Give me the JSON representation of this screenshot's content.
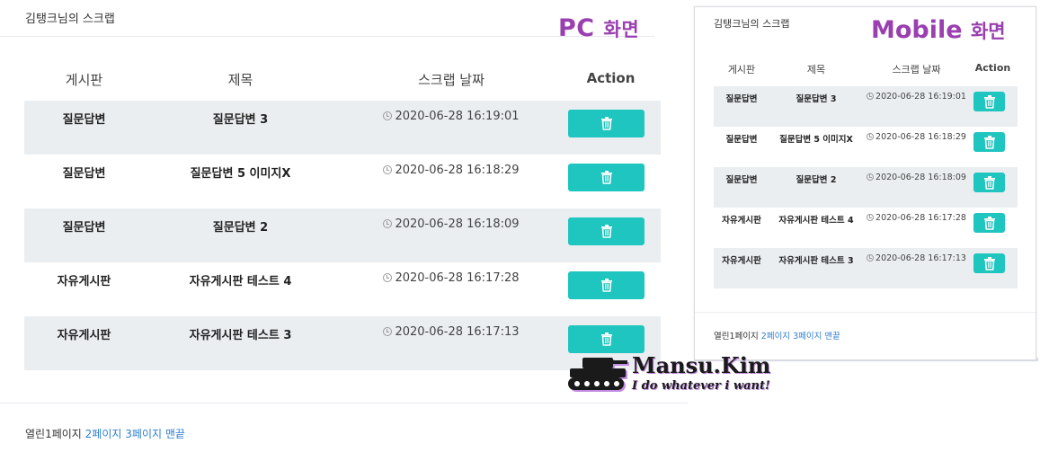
{
  "pc": {
    "title": "김탱크님의 스크랩",
    "badge_en": "PC",
    "badge_ko": "화면",
    "columns": [
      "게시판",
      "제목",
      "스크랩 날짜",
      "Action"
    ],
    "rows": [
      {
        "board": "질문답변",
        "title": "질문답변 3",
        "date": "2020-06-28 16:19:01"
      },
      {
        "board": "질문답변",
        "title": "질문답변 5 이미지X",
        "date": "2020-06-28 16:18:29"
      },
      {
        "board": "질문답변",
        "title": "질문답변 2",
        "date": "2020-06-28 16:18:09"
      },
      {
        "board": "자유게시판",
        "title": "자유게시판 테스트 4",
        "date": "2020-06-28 16:17:28"
      },
      {
        "board": "자유게시판",
        "title": "자유게시판 테스트 3",
        "date": "2020-06-28 16:17:13"
      }
    ],
    "pagination": {
      "current": "열린1페이지",
      "page2": "2페이지",
      "page3": "3페이지",
      "last": "맨끝"
    }
  },
  "mobile": {
    "title": "김탱크님의 스크랩",
    "badge_en": "Mobile",
    "badge_ko": "화면",
    "columns": [
      "게시판",
      "제목",
      "스크랩 날짜",
      "Action"
    ],
    "rows": [
      {
        "board": "질문답변",
        "title": "질문답변 3",
        "date": "2020-06-28 16:19:01"
      },
      {
        "board": "질문답변",
        "title": "질문답변 5 이미지X",
        "date": "2020-06-28 16:18:29"
      },
      {
        "board": "질문답변",
        "title": "질문답변 2",
        "date": "2020-06-28 16:18:09"
      },
      {
        "board": "자유게시판",
        "title": "자유게시판 테스트 4",
        "date": "2020-06-28 16:17:28"
      },
      {
        "board": "자유게시판",
        "title": "자유게시판 테스트 3",
        "date": "2020-06-28 16:17:13"
      }
    ],
    "pagination": {
      "current": "열린1페이지",
      "page2": "2페이지",
      "page3": "3페이지",
      "last": "맨끝"
    }
  },
  "watermark": {
    "name": "Mansu.Kim",
    "tagline": "I do whatever i want!"
  },
  "icons": {
    "delete": "trash-icon",
    "date": "clock-icon",
    "logo": "tank-icon"
  },
  "colors": {
    "accent": "#1fc5bf",
    "badge": "#9a3fb0",
    "link": "#2f7fd1",
    "stripe": "#ebeef1"
  }
}
